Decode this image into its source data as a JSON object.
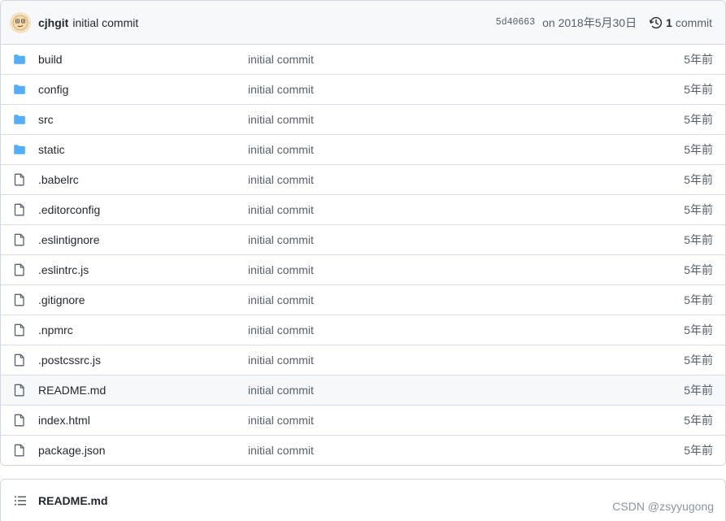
{
  "header": {
    "author": "cjhgit",
    "message": "initial commit",
    "sha": "5d40663",
    "date": "on 2018年5月30日",
    "commit_count": "1",
    "commit_label": "commit"
  },
  "files": [
    {
      "name": "build",
      "type": "folder",
      "message": "initial commit",
      "age": "5年前"
    },
    {
      "name": "config",
      "type": "folder",
      "message": "initial commit",
      "age": "5年前"
    },
    {
      "name": "src",
      "type": "folder",
      "message": "initial commit",
      "age": "5年前"
    },
    {
      "name": "static",
      "type": "folder",
      "message": "initial commit",
      "age": "5年前"
    },
    {
      "name": ".babelrc",
      "type": "file",
      "message": "initial commit",
      "age": "5年前"
    },
    {
      "name": ".editorconfig",
      "type": "file",
      "message": "initial commit",
      "age": "5年前"
    },
    {
      "name": ".eslintignore",
      "type": "file",
      "message": "initial commit",
      "age": "5年前"
    },
    {
      "name": ".eslintrc.js",
      "type": "file",
      "message": "initial commit",
      "age": "5年前"
    },
    {
      "name": ".gitignore",
      "type": "file",
      "message": "initial commit",
      "age": "5年前"
    },
    {
      "name": ".npmrc",
      "type": "file",
      "message": "initial commit",
      "age": "5年前"
    },
    {
      "name": ".postcssrc.js",
      "type": "file",
      "message": "initial commit",
      "age": "5年前"
    },
    {
      "name": "README.md",
      "type": "file",
      "message": "initial commit",
      "age": "5年前",
      "highlighted": true
    },
    {
      "name": "index.html",
      "type": "file",
      "message": "initial commit",
      "age": "5年前"
    },
    {
      "name": "package.json",
      "type": "file",
      "message": "initial commit",
      "age": "5年前"
    }
  ],
  "readme": {
    "title": "README.md"
  },
  "watermark": "CSDN @zsyyugong",
  "colors": {
    "folder": "#54aeff",
    "file_icon": "#57606a",
    "border": "#d0d7de",
    "header_bg": "#f6f8fa"
  },
  "icons": {
    "folder": "folder-icon",
    "file": "file-icon",
    "history": "history-icon",
    "list": "list-unordered-icon",
    "avatar": "avatar-icon"
  }
}
